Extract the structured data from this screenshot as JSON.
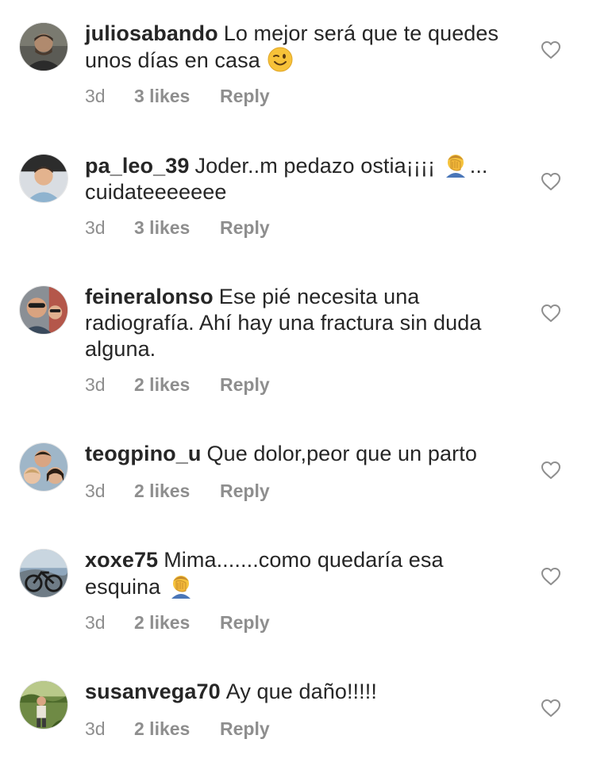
{
  "comments": [
    {
      "username": "juliosabando",
      "text": "Lo mejor será que te quedes unos días en casa",
      "emoji": "winking-face-emoji",
      "time": "3d",
      "likes": "3 likes",
      "reply": "Reply"
    },
    {
      "username": "pa_leo_39",
      "text": "Joder..m pedazo ostia¡¡¡¡",
      "emoji": "face-palm-emoji",
      "text_after": "... cuidateeeeeee",
      "time": "3d",
      "likes": "3 likes",
      "reply": "Reply"
    },
    {
      "username": "feineralonso",
      "text": "Ese pié necesita una radiografía. Ahí hay una fractura sin duda alguna.",
      "time": "3d",
      "likes": "2 likes",
      "reply": "Reply"
    },
    {
      "username": "teogpino_u",
      "text": "Que dolor,peor que un parto",
      "time": "3d",
      "likes": "2 likes",
      "reply": "Reply"
    },
    {
      "username": "xoxe75",
      "text": "Mima.......como quedaría esa esquina",
      "emoji": "face-palm-emoji",
      "time": "3d",
      "likes": "2 likes",
      "reply": "Reply"
    },
    {
      "username": "susanvega70",
      "text": "Ay que daño!!!!!",
      "time": "3d",
      "likes": "2 likes",
      "reply": "Reply"
    }
  ],
  "colors": {
    "text": "#262626",
    "meta": "#8e8e8e",
    "heart_outline": "#8e8e8e"
  },
  "icons": {
    "like": "heart-outline-icon"
  }
}
